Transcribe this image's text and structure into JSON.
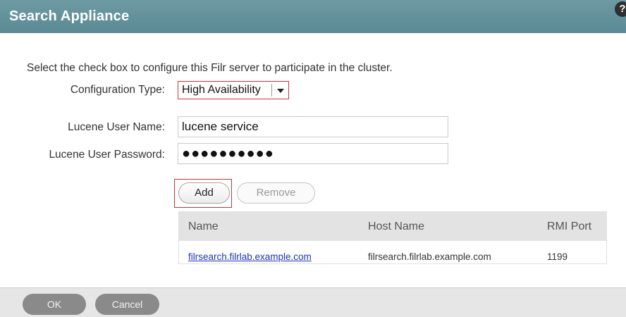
{
  "dialog": {
    "title": "Search Appliance",
    "help_glyph": "?"
  },
  "form": {
    "instruction": "Select the check box to configure this Filr server to participate in the cluster.",
    "config_type_label": "Configuration Type:",
    "config_type_value": "High Availability",
    "user_name_label": "Lucene User Name:",
    "user_name_value": "lucene service",
    "password_label": "Lucene User Password:",
    "password_value": "●●●●●●●●●●"
  },
  "actions": {
    "add_label": "Add",
    "remove_label": "Remove"
  },
  "table": {
    "headers": [
      "Name",
      "Host Name",
      "RMI Port"
    ],
    "rows": [
      [
        "filrsearch.filrlab.example.com",
        "filrsearch.filrlab.example.com",
        "1199"
      ]
    ]
  },
  "footer": {
    "ok_label": "OK",
    "cancel_label": "Cancel"
  },
  "colors": {
    "titlebar": "#5b8a94",
    "highlight_border": "#cc3333",
    "link": "#1b35b3"
  }
}
